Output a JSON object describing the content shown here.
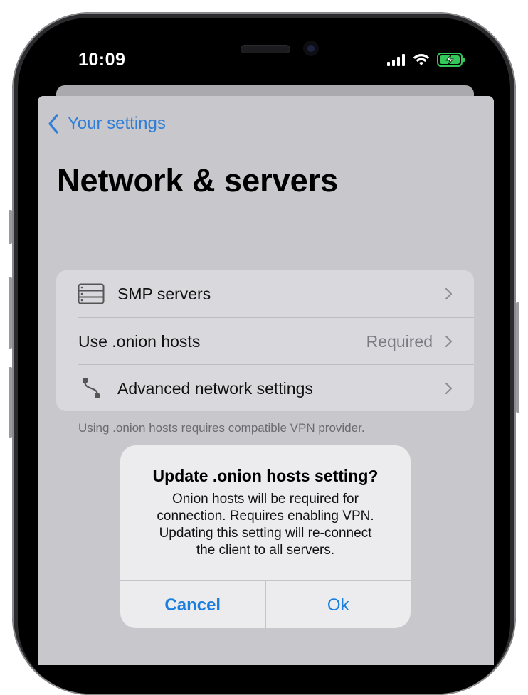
{
  "status_bar": {
    "time": "10:09"
  },
  "nav": {
    "back_label": "Your settings"
  },
  "page": {
    "title": "Network & servers"
  },
  "settings": {
    "rows": [
      {
        "label": "SMP servers",
        "value": "",
        "icon": "server-stack-icon"
      },
      {
        "label": "Use .onion hosts",
        "value": "Required",
        "icon": ""
      },
      {
        "label": "Advanced network settings",
        "value": "",
        "icon": "network-path-icon"
      }
    ],
    "footer": "Using .onion hosts requires compatible VPN provider."
  },
  "alert": {
    "title": "Update .onion hosts setting?",
    "message_lines": [
      "Onion hosts will be required for",
      "connection. Requires enabling VPN.",
      "Updating this setting will re-connect",
      "the client to all servers."
    ],
    "cancel_label": "Cancel",
    "ok_label": "Ok"
  },
  "colors": {
    "accent": "#2f7ed8",
    "battery": "#34c759",
    "screen_bg": "#c7c7cc"
  }
}
